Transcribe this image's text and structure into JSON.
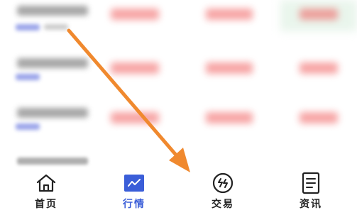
{
  "tab_bar": {
    "tabs": [
      {
        "label": "首页",
        "icon": "home-icon",
        "active": false
      },
      {
        "label": "行情",
        "icon": "market-chart-icon",
        "active": true
      },
      {
        "label": "交易",
        "icon": "trade-icon",
        "active": false
      },
      {
        "label": "资讯",
        "icon": "news-icon",
        "active": false
      }
    ],
    "active_color": "#3b5ed8",
    "inactive_color": "#222222"
  },
  "quote_list": {
    "rows_visible": 4,
    "up_color": "#f05a5a"
  },
  "annotation": {
    "arrow_color": "#f0892e"
  }
}
